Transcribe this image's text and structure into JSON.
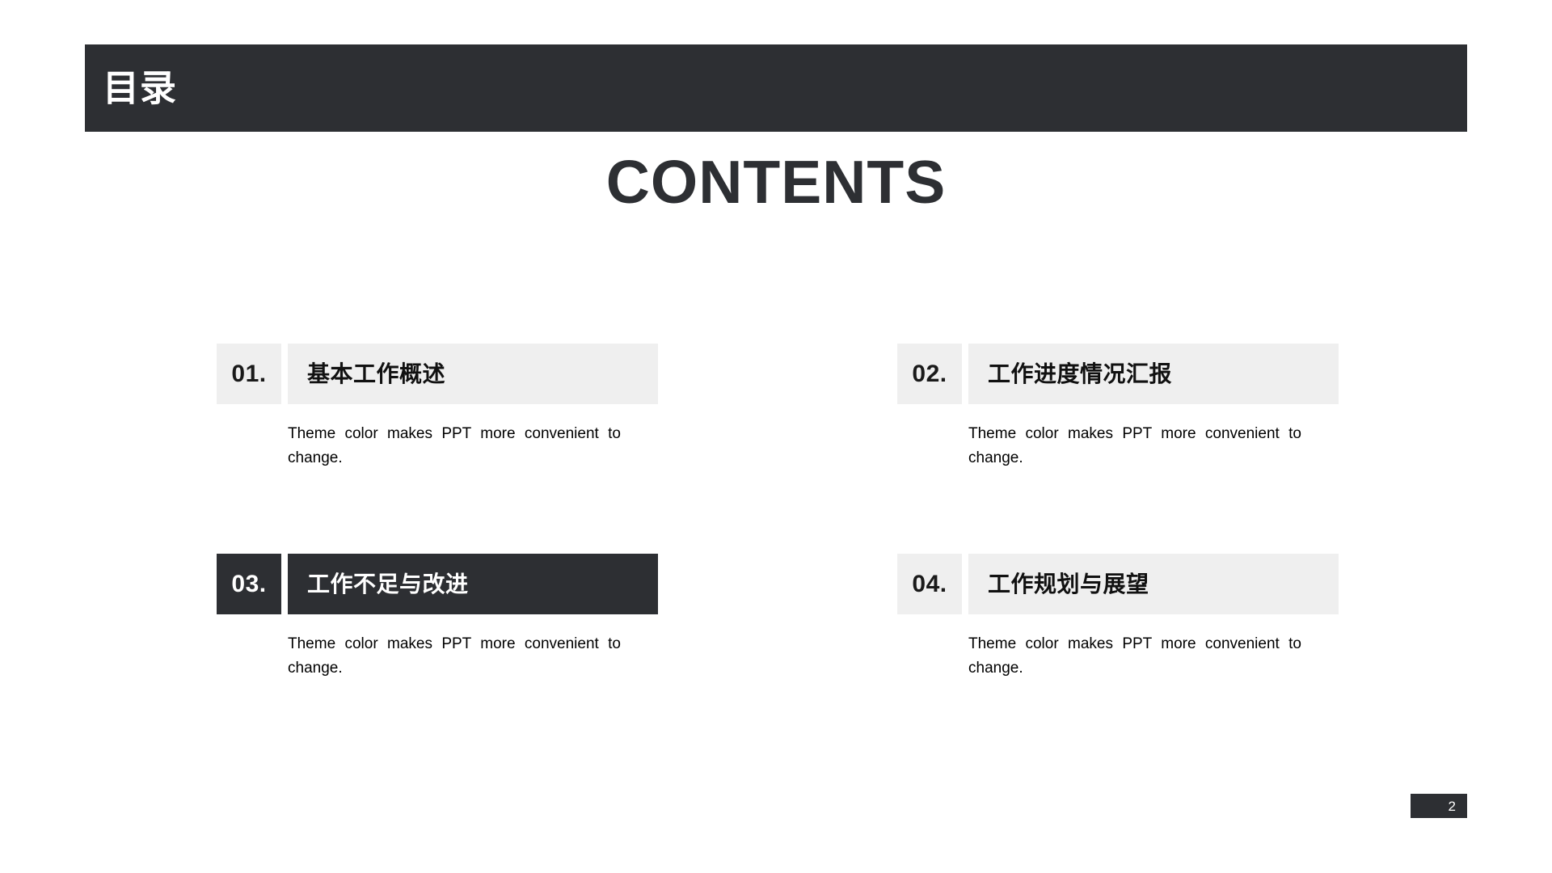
{
  "slide": {
    "background_color": "#ffffff",
    "accent_color": "#2d2f33",
    "panel_color": "#efefef"
  },
  "header": {
    "title": "目录"
  },
  "heading": {
    "text": "CONTENTS"
  },
  "toc": {
    "items": [
      {
        "number": "01.",
        "title": "基本工作概述",
        "description": "Theme color makes PPT more convenient to change.",
        "active": false
      },
      {
        "number": "02.",
        "title": "工作进度情况汇报",
        "description": "Theme color makes PPT more convenient to change.",
        "active": false
      },
      {
        "number": "03.",
        "title": "工作不足与改进",
        "description": "Theme color makes PPT more convenient to change.",
        "active": true
      },
      {
        "number": "04.",
        "title": "工作规划与展望",
        "description": "Theme color makes PPT more convenient to change.",
        "active": false
      }
    ]
  },
  "footer": {
    "page_number": "2"
  }
}
